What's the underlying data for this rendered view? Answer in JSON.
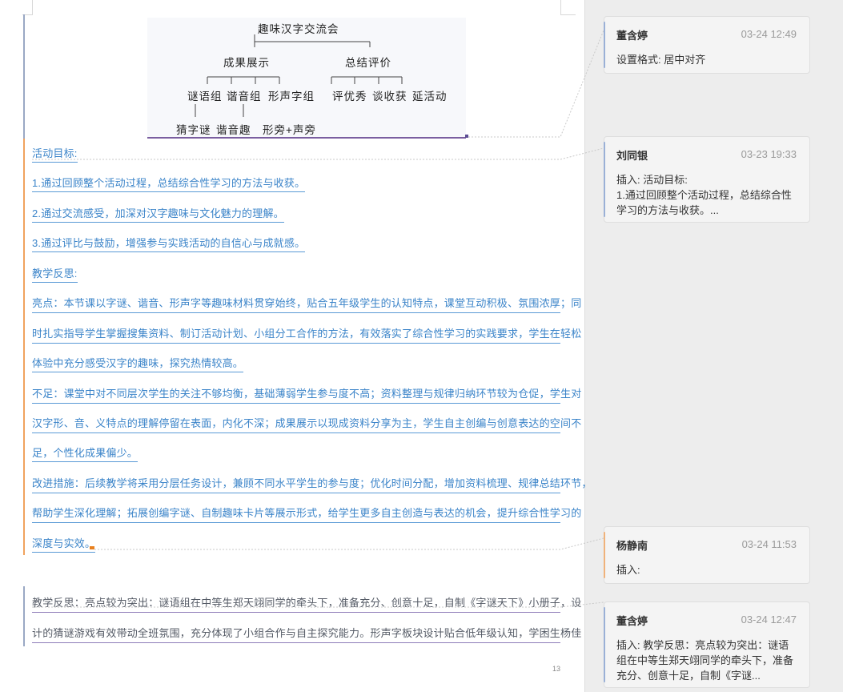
{
  "diagram": {
    "root": "趣味汉字交流会",
    "branch_left": "成果展示",
    "branch_right": "总结评价",
    "groups": [
      "谜语组",
      "谐音组",
      "形声字组"
    ],
    "evals": [
      "评优秀",
      "谈收获",
      "延活动"
    ],
    "leaves": [
      "猜字谜",
      "谐音趣",
      "形旁+声旁"
    ]
  },
  "document": {
    "goal_title": "活动目标:",
    "goal_1": "1.通过回顾整个活动过程，总结综合性学习的方法与收获。",
    "goal_2": "2.通过交流感受，加深对汉字趣味与文化魅力的理解。",
    "goal_3": "3.通过评比与鼓励，增强参与实践活动的自信心与成就感。",
    "reflect_title": "教学反思:",
    "p1_l1": "亮点：本节课以字谜、谐音、形声字等趣味材料贯穿始终，贴合五年级学生的认知特点，课堂互动积极、氛围浓厚；同",
    "p1_l2": "时扎实指导学生掌握搜集资料、制订活动计划、小组分工合作的方法，有效落实了综合性学习的实践要求，学生在轻松",
    "p1_l3": "体验中充分感受汉字的趣味，探究热情较高。",
    "p2_l1": "不足：课堂中对不同层次学生的关注不够均衡，基础薄弱学生参与度不高；资料整理与规律归纳环节较为仓促，学生对",
    "p2_l2": "汉字形、音、义特点的理解停留在表面，内化不深；成果展示以现成资料分享为主，学生自主创编与创意表达的空间不",
    "p2_l3": "足，个性化成果偏少。",
    "p3_l1": "改进措施：后续教学将采用分层任务设计，兼顾不同水平学生的参与度；优化时间分配，增加资料梳理、规律总结环节，",
    "p3_l2": "帮助学生深化理解；拓展创编字谜、自制趣味卡片等展示形式，给学生更多自主创造与表达的机会，提升综合性学习的",
    "p3_l3": "深度与实效。",
    "p4_l1": "教学反思：亮点较为突出：谜语组在中等生郑天翊同学的牵头下，准备充分、创意十足，自制《字谜天下》小册子，设",
    "p4_l2": "计的猜谜游戏有效带动全班氛围，充分体现了小组合作与自主探究能力。形声字板块设计贴合低年级认知，学困生杨佳",
    "page_number": "13"
  },
  "comments": [
    {
      "author": "董含婷",
      "time": "03-24 12:49",
      "body": "设置格式: 居中对齐"
    },
    {
      "author": "刘同银",
      "time": "03-23 19:33",
      "body": "插入: 活动目标:\n1.通过回顾整个活动过程，总结综合性学习的方法与收获。..."
    },
    {
      "author": "杨静南",
      "time": "03-24 11:53",
      "body": "插入:"
    },
    {
      "author": "董含婷",
      "time": "03-24 12:47",
      "body": "插入: 教学反思：亮点较为突出：谜语组在中等生郑天翊同学的牵头下，准备充分、创意十足，自制《字谜..."
    }
  ],
  "colors": {
    "insert_text": "#3b84c9",
    "comment_bar": "#9ab0d6",
    "comment_bar_alt": "#f0b27a"
  }
}
